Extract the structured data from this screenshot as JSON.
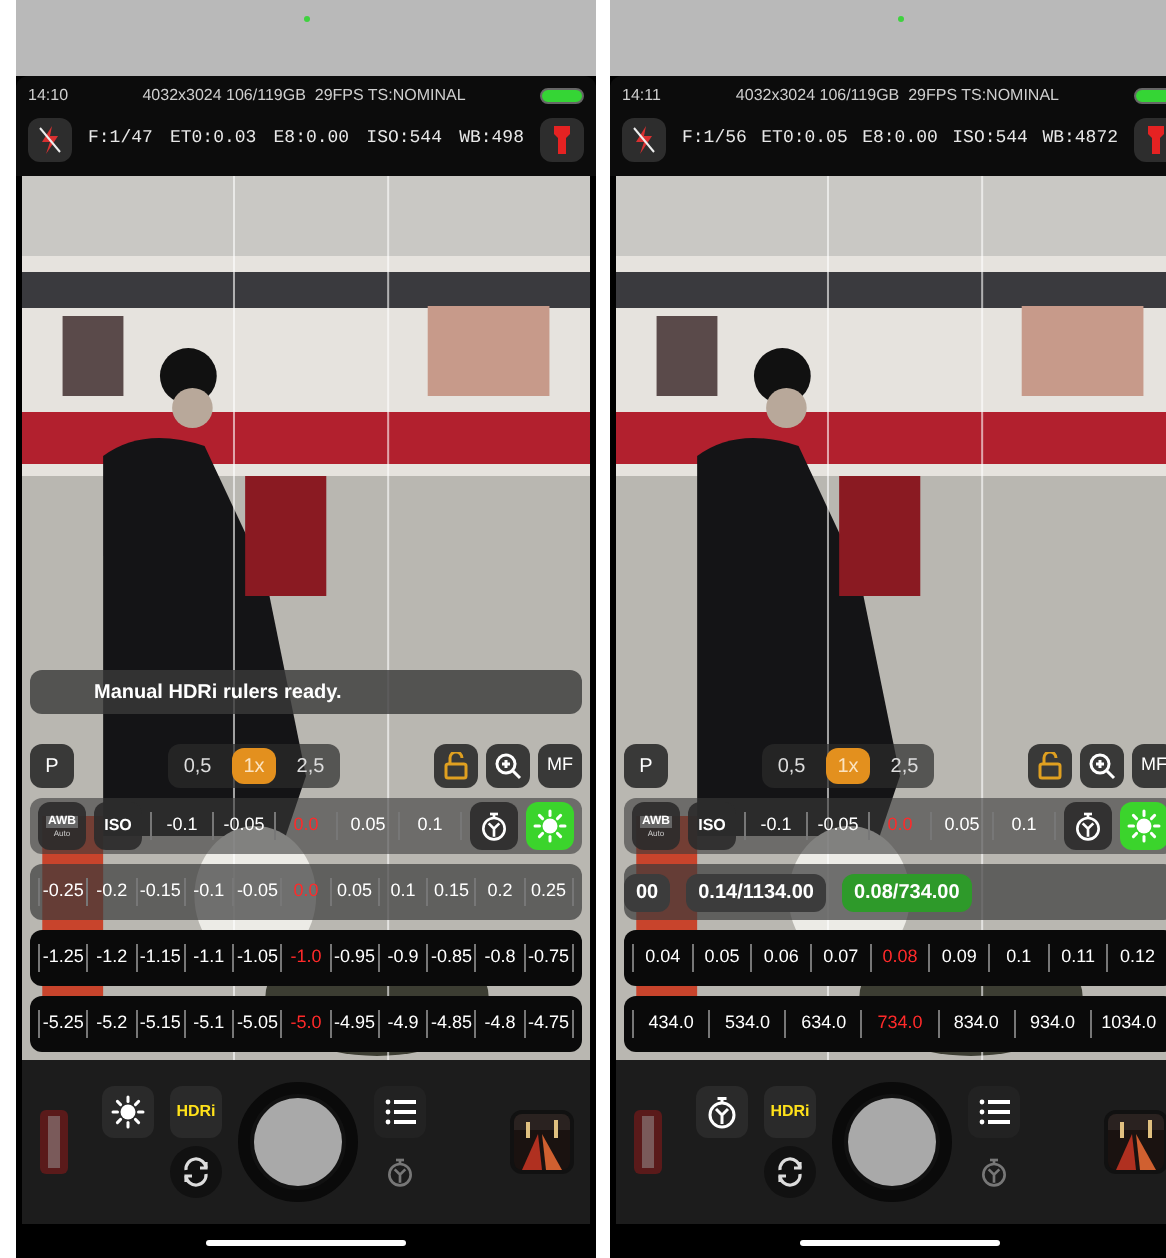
{
  "phones": [
    {
      "status": {
        "time": "14:10",
        "info": "4032x3024 106/119GB  29FPS TS:NOMINAL"
      },
      "readouts": [
        "F:1/47",
        "ET0:0.03",
        "E8:0.00",
        "ISO:544",
        "WB:498"
      ],
      "toast": "Manual HDRi rulers ready.",
      "mode": "P",
      "zoom": [
        {
          "label": "0,5",
          "selected": false
        },
        {
          "label": "1x",
          "selected": true
        },
        {
          "label": "2,5",
          "selected": false
        }
      ],
      "focus": "MF",
      "wb_row": {
        "awb": "AWB",
        "awb_sub": "Auto",
        "iso": "ISO",
        "values": [
          {
            "text": "-0.1",
            "selected": false
          },
          {
            "text": "-0.05",
            "selected": false
          },
          {
            "text": "0.0",
            "selected": true
          },
          {
            "text": "0.05",
            "selected": false
          },
          {
            "text": "0.1",
            "selected": false
          }
        ]
      },
      "rows": [
        {
          "kind": "ruler",
          "dark": false,
          "values": [
            {
              "text": "-0.25",
              "selected": false
            },
            {
              "text": "-0.2",
              "selected": false
            },
            {
              "text": "-0.15",
              "selected": false
            },
            {
              "text": "-0.1",
              "selected": false
            },
            {
              "text": "-0.05",
              "selected": false
            },
            {
              "text": "0.0",
              "selected": true
            },
            {
              "text": "0.05",
              "selected": false
            },
            {
              "text": "0.1",
              "selected": false
            },
            {
              "text": "0.15",
              "selected": false
            },
            {
              "text": "0.2",
              "selected": false
            },
            {
              "text": "0.25",
              "selected": false
            }
          ]
        },
        {
          "kind": "ruler",
          "dark": true,
          "values": [
            {
              "text": "-1.25",
              "selected": false
            },
            {
              "text": "-1.2",
              "selected": false
            },
            {
              "text": "-1.15",
              "selected": false
            },
            {
              "text": "-1.1",
              "selected": false
            },
            {
              "text": "-1.05",
              "selected": false
            },
            {
              "text": "-1.0",
              "selected": true
            },
            {
              "text": "-0.95",
              "selected": false
            },
            {
              "text": "-0.9",
              "selected": false
            },
            {
              "text": "-0.85",
              "selected": false
            },
            {
              "text": "-0.8",
              "selected": false
            },
            {
              "text": "-0.75",
              "selected": false
            }
          ]
        },
        {
          "kind": "ruler",
          "dark": true,
          "values": [
            {
              "text": "-5.25",
              "selected": false
            },
            {
              "text": "-5.2",
              "selected": false
            },
            {
              "text": "-5.15",
              "selected": false
            },
            {
              "text": "-5.1",
              "selected": false
            },
            {
              "text": "-5.05",
              "selected": false
            },
            {
              "text": "-5.0",
              "selected": true
            },
            {
              "text": "-4.95",
              "selected": false
            },
            {
              "text": "-4.9",
              "selected": false
            },
            {
              "text": "-4.85",
              "selected": false
            },
            {
              "text": "-4.8",
              "selected": false
            },
            {
              "text": "-4.75",
              "selected": false
            }
          ]
        }
      ],
      "bottom": {
        "kind": "sun",
        "hdr": "HDRi"
      }
    },
    {
      "status": {
        "time": "14:11",
        "info": "4032x3024 106/119GB  29FPS TS:NOMINAL"
      },
      "readouts": [
        "F:1/56",
        "ET0:0.05",
        "E8:0.00",
        "ISO:544",
        "WB:4872"
      ],
      "mode": "P",
      "zoom": [
        {
          "label": "0,5",
          "selected": false
        },
        {
          "label": "1x",
          "selected": true
        },
        {
          "label": "2,5",
          "selected": false
        }
      ],
      "focus": "MF",
      "wb_row": {
        "awb": "AWB",
        "awb_sub": "Auto",
        "iso": "ISO",
        "values": [
          {
            "text": "-0.1",
            "selected": false
          },
          {
            "text": "-0.05",
            "selected": false
          },
          {
            "text": "0.0",
            "selected": true
          },
          {
            "text": "0.05",
            "selected": false
          },
          {
            "text": "0.1",
            "selected": false
          }
        ]
      },
      "rows": [
        {
          "kind": "chips",
          "dark": false,
          "values": [
            {
              "text": "00",
              "selected": false
            },
            {
              "text": "0.14/1134.00",
              "selected": false
            },
            {
              "text": "0.08/734.00",
              "selected": true
            }
          ]
        },
        {
          "kind": "ruler",
          "dark": true,
          "values": [
            {
              "text": "0.04",
              "selected": false
            },
            {
              "text": "0.05",
              "selected": false
            },
            {
              "text": "0.06",
              "selected": false
            },
            {
              "text": "0.07",
              "selected": false
            },
            {
              "text": "0.08",
              "selected": true
            },
            {
              "text": "0.09",
              "selected": false
            },
            {
              "text": "0.1",
              "selected": false
            },
            {
              "text": "0.11",
              "selected": false
            },
            {
              "text": "0.12",
              "selected": false
            }
          ]
        },
        {
          "kind": "ruler",
          "dark": true,
          "values": [
            {
              "text": "434.0",
              "selected": false
            },
            {
              "text": "534.0",
              "selected": false
            },
            {
              "text": "634.0",
              "selected": false
            },
            {
              "text": "734.0",
              "selected": true
            },
            {
              "text": "834.0",
              "selected": false
            },
            {
              "text": "934.0",
              "selected": false
            },
            {
              "text": "1034.0",
              "selected": false
            }
          ]
        }
      ],
      "bottom": {
        "kind": "timer",
        "hdr": "HDRi"
      }
    }
  ]
}
